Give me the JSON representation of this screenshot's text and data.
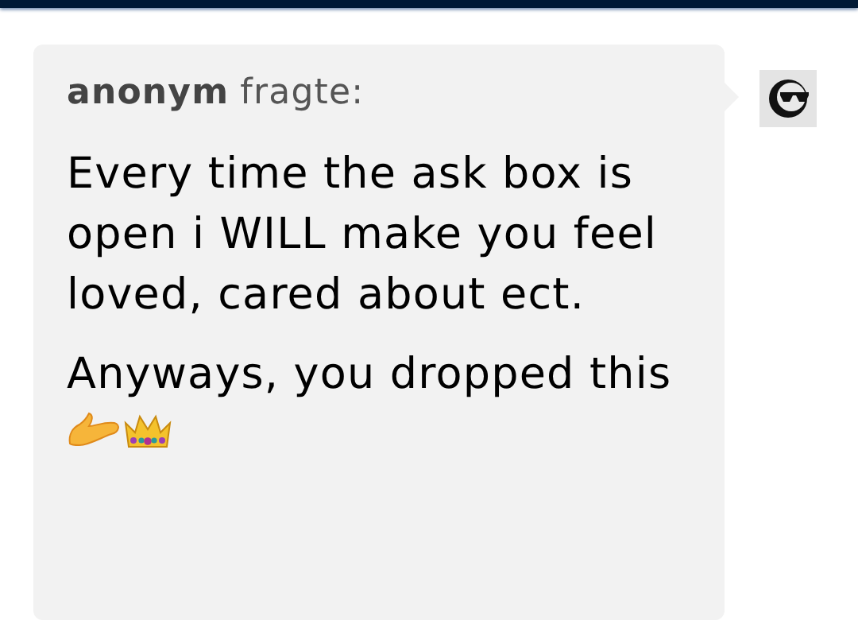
{
  "ask": {
    "asker": "anonym",
    "verb": "fragte:",
    "paragraphs": [
      "Every time the ask box is open i WILL make you feel loved, cared about ect.",
      "Anyways, you dropped this"
    ]
  }
}
